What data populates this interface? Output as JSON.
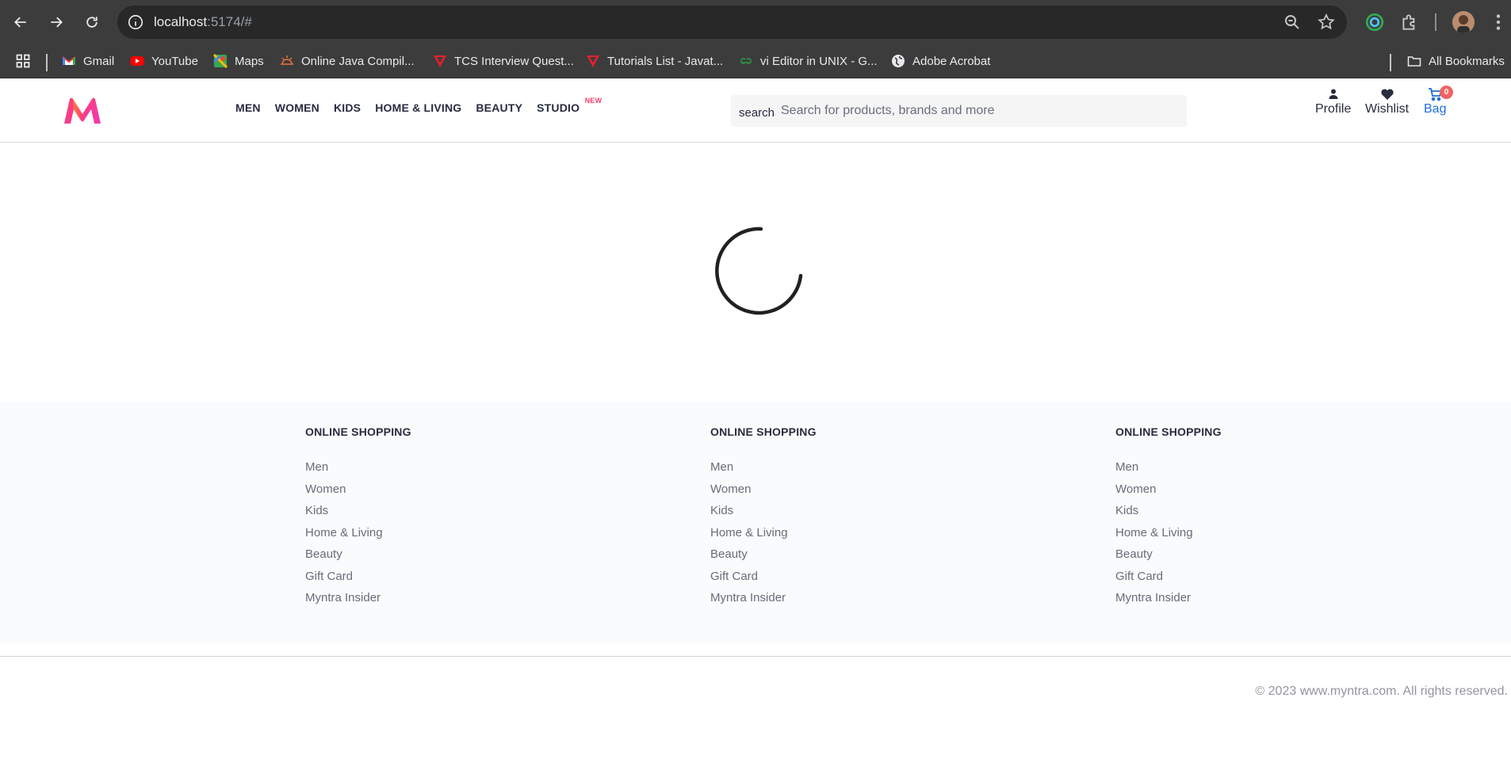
{
  "browser": {
    "url_host": "localhost",
    "url_rest": ":5174/#",
    "bookmarks": [
      {
        "label": "Gmail",
        "icon": "gmail-icon"
      },
      {
        "label": "YouTube",
        "icon": "youtube-icon"
      },
      {
        "label": "Maps",
        "icon": "maps-icon"
      },
      {
        "label": "Online Java Compil...",
        "icon": "sun-icon"
      },
      {
        "label": "TCS Interview Quest...",
        "icon": "javatpoint-icon"
      },
      {
        "label": "Tutorials List - Javat...",
        "icon": "javatpoint-icon"
      },
      {
        "label": "vi Editor in UNIX - G...",
        "icon": "gfg-icon"
      },
      {
        "label": "Adobe Acrobat",
        "icon": "globe-icon"
      }
    ],
    "all_bookmarks_label": "All Bookmarks"
  },
  "header": {
    "nav": [
      {
        "label": "MEN"
      },
      {
        "label": "WOMEN"
      },
      {
        "label": "KIDS"
      },
      {
        "label": "HOME & LIVING"
      },
      {
        "label": "BEAUTY"
      },
      {
        "label": "STUDIO",
        "badge": "NEW"
      }
    ],
    "search": {
      "label": "search",
      "placeholder": "Search for products, brands and more"
    },
    "actions": {
      "profile": "Profile",
      "wishlist": "Wishlist",
      "bag": "Bag",
      "bag_count": "0"
    }
  },
  "footer": {
    "columns": [
      {
        "title": "ONLINE SHOPPING",
        "links": [
          "Men",
          "Women",
          "Kids",
          "Home & Living",
          "Beauty",
          "Gift Card",
          "Myntra Insider"
        ]
      },
      {
        "title": "ONLINE SHOPPING",
        "links": [
          "Men",
          "Women",
          "Kids",
          "Home & Living",
          "Beauty",
          "Gift Card",
          "Myntra Insider"
        ]
      },
      {
        "title": "ONLINE SHOPPING",
        "links": [
          "Men",
          "Women",
          "Kids",
          "Home & Living",
          "Beauty",
          "Gift Card",
          "Myntra Insider"
        ]
      }
    ],
    "copyright": "© 2023 www.myntra.com. All rights reserved."
  },
  "colors": {
    "brand_pink": "#ff3f6c",
    "bag_blue": "#1e6fd9",
    "chrome_bg": "#3c3c3c"
  }
}
